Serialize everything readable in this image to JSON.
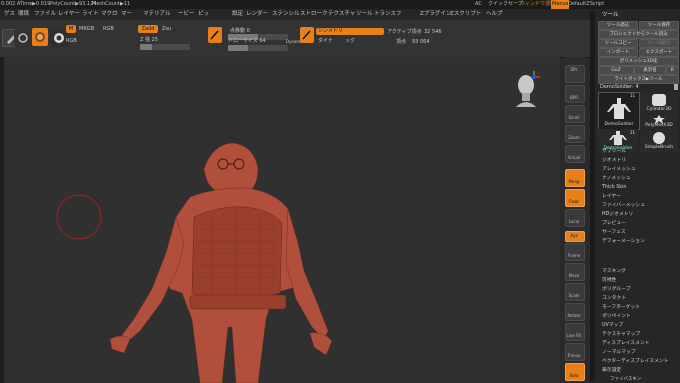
{
  "status": {
    "fields": [
      "0.002 ATime▶0.019",
      "PolyCount▶93.124",
      "MeshCount▶11"
    ],
    "right": [
      "AC",
      "クイックセーブ",
      "ウィンドウ透明度",
      "Menus",
      "DefaultZScript"
    ]
  },
  "menubar": [
    "ゲス",
    "環境",
    "ファイル",
    "レイヤー",
    "ライト",
    "マクロ",
    "マー",
    "マテリアル",
    "ービー",
    "ピッ",
    "設定",
    "レンダー",
    "ステンシル",
    "ストローク",
    "テクスチャ",
    "ツール",
    "トランスフ",
    "Zプラグイン",
    "Zスクリプト",
    "ヘルプ"
  ],
  "toolbar": {
    "zadd": "Zadd",
    "zsub": "Zsu",
    "m": "M",
    "mrgb": "MRGB",
    "rgb": "RGB",
    "intensity": "Z 強 25",
    "rgb_intensity": "RGB",
    "focal": "点移動 0",
    "draw_size": "ドローサイズ 64",
    "dynamic": "Dynamic",
    "symmetry": "シンメトリ",
    "active_points_label": "アクティブ頂点",
    "active_points": "32 546",
    "dyna": "ダイナ",
    "total_label": "頂点",
    "total_points": "93 064",
    "undo": "ック"
  },
  "right_icons": {
    "sps": "SPs",
    "bpr": "BPR",
    "scroll": "Scroll",
    "zoom": "Zoom",
    "actual": "Actual",
    "aahalf": "AAHalf",
    "persp": "Persp",
    "floor": "Floor",
    "local": "Local",
    "xyz": "Xyz",
    "frame": "Frame",
    "move": "Move",
    "scale": "Scale",
    "rotate": "Rotate",
    "linefill": "Line Fill",
    "transp": "Transp",
    "solo": "Solo"
  },
  "panel": {
    "title": "ツール",
    "buttons": [
      "ツール読込",
      "ツール保存",
      "プロジェクトからツール読込",
      "ツールコピー",
      "ツール貼り",
      "インポート",
      "エクスポート",
      "ポリメッシュ3D化",
      "GoZ",
      "表示名",
      "R",
      "ライトボックス▶ツール"
    ],
    "current_tool": "DemoSoldier: 4",
    "thumbs": [
      "DemoSoldier",
      "Cylinder3D",
      "PolyMesh3D",
      "DemoSoldier",
      "SimpleBrush"
    ],
    "thumb_counts": [
      "11",
      "11"
    ],
    "subpalettes": [
      "サブツール",
      "ジオメトリ",
      "アレイメッシュ",
      "ナノメッシュ",
      "Thick Skin",
      "レイヤー",
      "ファイバーメッシュ",
      "HDジオメトリ",
      "プレビュー",
      "サーフェス",
      "デフォーメーション",
      "マスキング",
      "可視性",
      "ポリグループ",
      "コンタクト",
      "モーフターゲット",
      "ポリペイント",
      "UVマップ",
      "テクスチャマップ",
      "ディスプレイスメント",
      "ノーマルマップ",
      "ベクターディスプレイスメント",
      "表示設定",
      "ファイバスキン",
      "イニシャライズ",
      "インポート",
      "エクスポート"
    ]
  },
  "colors": {
    "accent": "#e8801a",
    "model": "#b0503c"
  }
}
